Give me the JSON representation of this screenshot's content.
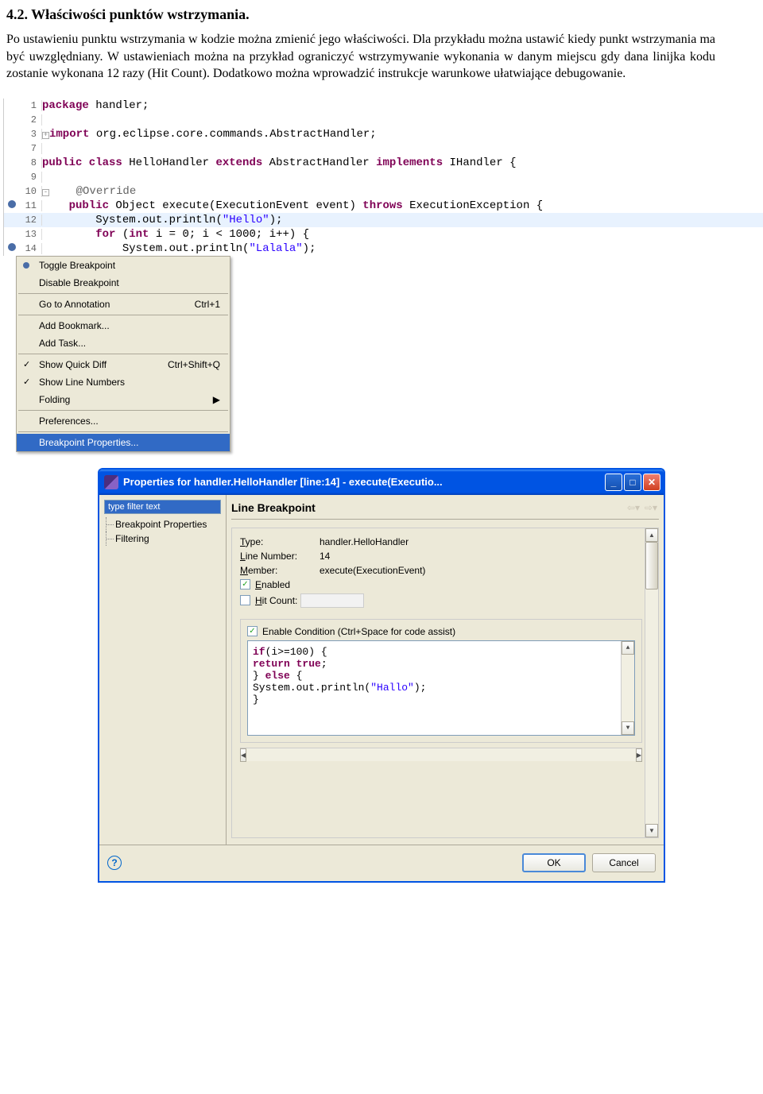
{
  "doc": {
    "section_title": "4.2. Właściwości punktów wstrzymania.",
    "paragraph": "Po ustawieniu punktu wstrzymania w kodzie można zmienić jego właściwości. Dla przykładu można ustawić kiedy punkt wstrzymania ma być uwzględniany. W ustawieniach można na przykład ograniczyć wstrzymywanie wykonania w danym miejscu gdy dana linijka kodu zostanie wykonana 12 razy (Hit Count). Dodatkowo można wprowadzić instrukcje warunkowe ułatwiające debugowanie."
  },
  "editor": {
    "lines": [
      {
        "num": "1",
        "tokens": [
          [
            "kw",
            "package"
          ],
          [
            "",
            " handler;"
          ]
        ]
      },
      {
        "num": "2",
        "tokens": []
      },
      {
        "num": "3",
        "expand": "+",
        "tokens": [
          [
            "kw",
            "import"
          ],
          [
            "",
            " org.eclipse.core.commands.AbstractHandler;"
          ]
        ]
      },
      {
        "num": "7",
        "tokens": []
      },
      {
        "num": "8",
        "tokens": [
          [
            "kw",
            "public class"
          ],
          [
            "",
            " HelloHandler "
          ],
          [
            "kw",
            "extends"
          ],
          [
            "",
            " AbstractHandler "
          ],
          [
            "kw",
            "implements"
          ],
          [
            "",
            " IHandler {"
          ]
        ]
      },
      {
        "num": "9",
        "tokens": []
      },
      {
        "num": "10",
        "expand": "-",
        "tokens": [
          [
            "",
            "    "
          ],
          [
            "ann",
            "@Override"
          ]
        ]
      },
      {
        "num": "11",
        "marker": true,
        "tokens": [
          [
            "",
            "    "
          ],
          [
            "kw",
            "public"
          ],
          [
            "",
            " Object execute(ExecutionEvent event) "
          ],
          [
            "kw",
            "throws"
          ],
          [
            "",
            " ExecutionException {"
          ]
        ]
      },
      {
        "num": "12",
        "highlight": true,
        "tokens": [
          [
            "",
            "        System."
          ],
          [
            "",
            "out"
          ],
          [
            "",
            ".println("
          ],
          [
            "str",
            "\"Hello\""
          ],
          [
            "",
            ");"
          ]
        ]
      },
      {
        "num": "13",
        "tokens": [
          [
            "",
            "        "
          ],
          [
            "kw",
            "for"
          ],
          [
            "",
            " ("
          ],
          [
            "kw",
            "int"
          ],
          [
            "",
            " i = 0; i < 1000; i++) {"
          ]
        ]
      },
      {
        "num": "14",
        "marker": true,
        "tokens": [
          [
            "",
            "            System.out.println("
          ],
          [
            "str",
            "\"Lalala\""
          ],
          [
            "",
            ");"
          ]
        ]
      }
    ]
  },
  "menu": {
    "items": [
      {
        "label": "Toggle Breakpoint",
        "bullet": true
      },
      {
        "label": "Disable Breakpoint"
      },
      {
        "sep": true
      },
      {
        "label": "Go to Annotation",
        "shortcut": "Ctrl+1"
      },
      {
        "sep": true
      },
      {
        "label": "Add Bookmark..."
      },
      {
        "label": "Add Task..."
      },
      {
        "sep": true
      },
      {
        "label": "Show Quick Diff",
        "shortcut": "Ctrl+Shift+Q",
        "check": true
      },
      {
        "label": "Show Line Numbers",
        "check": true
      },
      {
        "label": "Folding",
        "arrow": true
      },
      {
        "sep": true
      },
      {
        "label": "Preferences..."
      },
      {
        "sep": true
      },
      {
        "label": "Breakpoint Properties...",
        "sel": true
      }
    ]
  },
  "dialog": {
    "title": "Properties for handler.HelloHandler [line:14] - execute(Executio...",
    "filter_placeholder": "type filter text",
    "tree": [
      "Breakpoint Properties",
      "Filtering"
    ],
    "panel_title": "Line Breakpoint",
    "type_label": "Type:",
    "type_value": "handler.HelloHandler",
    "line_label": "Line Number:",
    "line_value": "14",
    "member_label": "Member:",
    "member_value": "execute(ExecutionEvent)",
    "enabled_label": "Enabled",
    "hit_label": "Hit Count:",
    "condition_label": "Enable Condition (Ctrl+Space for code assist)",
    "condition_code": [
      [
        [
          "cb-kw",
          "if"
        ],
        [
          "",
          "(i>=100) {"
        ]
      ],
      [
        [
          "",
          "    "
        ],
        [
          "cb-kw",
          "return true"
        ],
        [
          "",
          ";"
        ]
      ],
      [
        [
          "",
          "} "
        ],
        [
          "cb-kw",
          "else"
        ],
        [
          "",
          " {"
        ]
      ],
      [
        [
          "",
          "    System."
        ],
        [
          "",
          "out"
        ],
        [
          "",
          ".println("
        ],
        [
          "cb-str",
          "\"Hallo\""
        ],
        [
          "",
          ");"
        ]
      ],
      [
        [
          "",
          "}"
        ]
      ]
    ],
    "ok": "OK",
    "cancel": "Cancel"
  }
}
